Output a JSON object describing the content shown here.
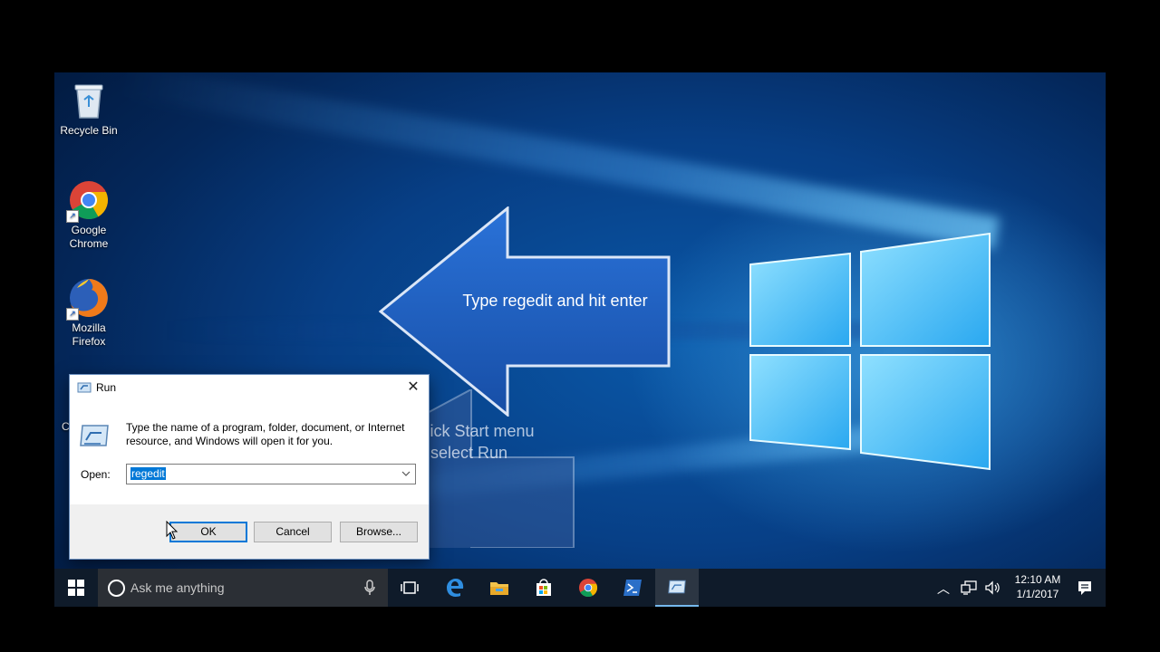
{
  "desktop": {
    "icons": [
      {
        "label": "Recycle Bin",
        "icon": "recycle-bin-icon"
      },
      {
        "label": "Google Chrome",
        "icon": "chrome-icon"
      },
      {
        "label": "Mozilla Firefox",
        "icon": "firefox-icon"
      }
    ],
    "partial_label": "C"
  },
  "callouts": {
    "main": "Type regedit and hit enter",
    "ghost": "Right Click Start menu and select Run"
  },
  "run_dialog": {
    "title": "Run",
    "description": "Type the name of a program, folder, document, or Internet resource, and Windows will open it for you.",
    "open_label": "Open:",
    "open_value": "regedit",
    "buttons": {
      "ok": "OK",
      "cancel": "Cancel",
      "browse": "Browse..."
    }
  },
  "taskbar": {
    "search_placeholder": "Ask me anything",
    "apps": [
      "task-view-icon",
      "edge-icon",
      "file-explorer-icon",
      "store-icon",
      "chrome-icon",
      "powershell-icon",
      "run-icon"
    ],
    "clock": {
      "time": "12:10 AM",
      "date": "1/1/2017"
    }
  },
  "colors": {
    "accent": "#0078d7",
    "taskbar": "#0f1b2a",
    "callout": "#1a5ec8"
  }
}
